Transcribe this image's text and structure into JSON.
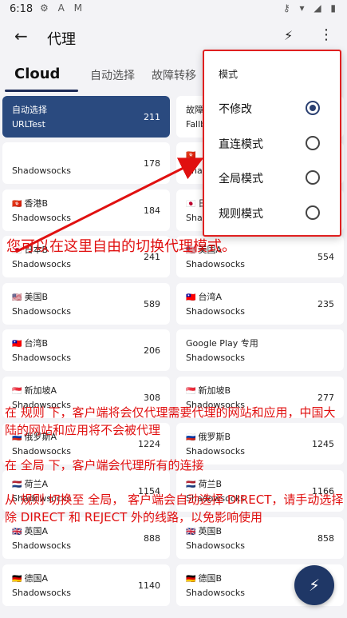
{
  "status": {
    "time": "6:18",
    "left_icons": "⚙ A M",
    "right_icons": "⚷ ▾ ◢ ▮"
  },
  "appbar": {
    "title": "代理"
  },
  "tabs": [
    {
      "label": "Cloud"
    },
    {
      "label": "自动选择"
    },
    {
      "label": "故障转移"
    }
  ],
  "cards": [
    {
      "name": "自动选择",
      "type": "URLTest",
      "delay": "211",
      "selected": true
    },
    {
      "name": "故障",
      "type": "Fallb",
      "delay": ""
    },
    {
      "name": "",
      "type": "Shadowsocks",
      "delay": "178"
    },
    {
      "name": "",
      "type": "Shadowsocks",
      "delay": ""
    },
    {
      "name": "香港B",
      "type": "Shadowsocks",
      "delay": "184"
    },
    {
      "name": "日",
      "type": "Shado",
      "delay": ""
    },
    {
      "name": "日本B",
      "type": "Shadowsocks",
      "delay": "241"
    },
    {
      "name": "美国A",
      "type": "Shadowsocks",
      "delay": "554"
    },
    {
      "name": "美国B",
      "type": "Shadowsocks",
      "delay": "589"
    },
    {
      "name": "台湾A",
      "type": "Shadowsocks",
      "delay": "235"
    },
    {
      "name": "台湾B",
      "type": "Shadowsocks",
      "delay": "206"
    },
    {
      "name": "Google Play 专用",
      "type": "Shadowsocks",
      "delay": ""
    },
    {
      "name": "新加坡A",
      "type": "Shadowsocks",
      "delay": "308"
    },
    {
      "name": "新加坡B",
      "type": "Shadowsocks",
      "delay": "277"
    },
    {
      "name": "俄罗斯A",
      "type": "Shadowsocks",
      "delay": "1224"
    },
    {
      "name": "俄罗斯B",
      "type": "Shadowsocks",
      "delay": "1245"
    },
    {
      "name": "荷兰A",
      "type": "Shadowsocks",
      "delay": "1154"
    },
    {
      "name": "荷兰B",
      "type": "Shadowsocks",
      "delay": "1166"
    },
    {
      "name": "英国A",
      "type": "Shadowsocks",
      "delay": "888"
    },
    {
      "name": "英国B",
      "type": "Shadowsocks",
      "delay": "858"
    },
    {
      "name": "德国A",
      "type": "Shadowsocks",
      "delay": "1140"
    },
    {
      "name": "德国B",
      "type": "Shadowsocks",
      "delay": ""
    }
  ],
  "mode_menu": {
    "title": "模式",
    "options": [
      {
        "label": "不修改",
        "checked": true
      },
      {
        "label": "直连模式",
        "checked": false
      },
      {
        "label": "全局模式",
        "checked": false
      },
      {
        "label": "规则模式",
        "checked": false
      }
    ]
  },
  "annotations": {
    "headline": "您可以在这里自由的切换代理模式。",
    "rule_mode": "在 规则 下，客户端将会仅代理需要代理的网站和应用，中国大陆的网站和应用将不会被代理",
    "global_mode": "在 全局 下，客户端会代理所有的连接",
    "switch_note": "从 规则 切换至 全局， 客户端会自动选择 DIRECT，请手动选择除 DIRECT 和 REJECT 外的线路，以免影响使用"
  },
  "colors": {
    "accent": "#1f3766",
    "selected_card": "#2a4a7f",
    "annotation": "#e01010"
  }
}
